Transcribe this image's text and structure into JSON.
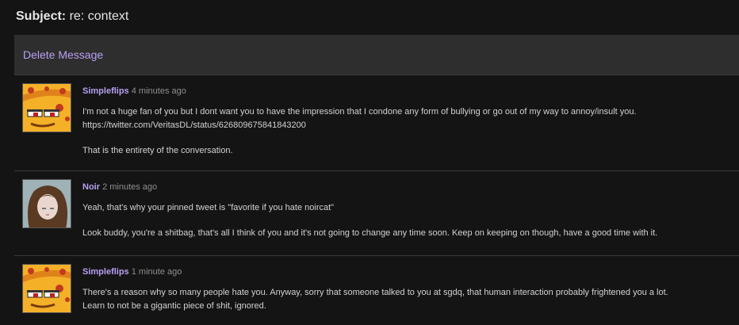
{
  "subject": {
    "label": "Subject:",
    "text": "re: context"
  },
  "toolbar": {
    "delete_label": "Delete Message"
  },
  "messages": [
    {
      "user": "Simpleflips",
      "time": "4 minutes ago",
      "avatar_icon": "pizza-avatar",
      "lines": [
        "I'm not a huge fan of you but I dont want you to have the impression that I condone any form of bullying or go out of my way to annoy/insult you.",
        "https://twitter.com/VeritasDL/status/626809675841843200",
        "That is the entirety of the conversation."
      ]
    },
    {
      "user": "Noir",
      "time": "2 minutes ago",
      "avatar_icon": "anime-girl-avatar",
      "lines": [
        "Yeah, that's why your pinned tweet is \"favorite if you hate noircat\"",
        "Look buddy, you're a shitbag, that's all I think of you and it's not going to change any time soon. Keep on keeping on though, have a good time with it."
      ]
    },
    {
      "user": "Simpleflips",
      "time": "1 minute ago",
      "avatar_icon": "pizza-avatar",
      "lines": [
        "There's a reason why so many people hate you. Anyway, sorry that someone talked to you at sgdq, that human interaction probably frightened you a lot.",
        "Learn to not be a gigantic piece of shit, ignored."
      ]
    }
  ],
  "colors": {
    "background": "#141414",
    "toolbar": "#2e2e2e",
    "accent": "#b7a1f2",
    "text": "#d2d2d2",
    "muted": "#8f8f8f"
  }
}
